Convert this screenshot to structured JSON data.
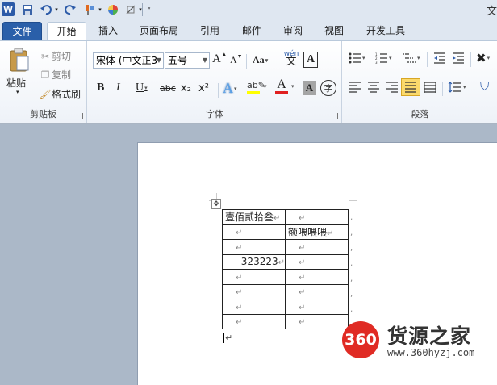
{
  "window": {
    "title_partial": "文"
  },
  "qat": {
    "logo": "W",
    "undo_icon": "undo-icon",
    "redo_icon": "redo-icon"
  },
  "tabs": [
    "文件",
    "开始",
    "插入",
    "页面布局",
    "引用",
    "邮件",
    "审阅",
    "视图",
    "开发工具"
  ],
  "active_tab": "开始",
  "clipboard": {
    "paste": "粘贴",
    "cut": "剪切",
    "copy": "复制",
    "format_painter": "格式刷",
    "label": "剪贴板"
  },
  "font": {
    "font_name": "宋体 (中文正3",
    "font_size": "五号",
    "grow": "A",
    "shrink": "A",
    "case": "Aa",
    "wen": "文",
    "bold": "B",
    "italic": "I",
    "underline": "U",
    "strike": "abc",
    "sub": "x₂",
    "sup": "x²",
    "char_shade": "A",
    "enclose": "字",
    "label": "字体"
  },
  "paragraph": {
    "label": "段落"
  },
  "table": {
    "rows": [
      [
        "壹佰贰拾叁",
        ""
      ],
      [
        "",
        "额喂喂喂"
      ],
      [
        "",
        ""
      ],
      [
        "323223",
        ""
      ],
      [
        "",
        ""
      ],
      [
        "",
        ""
      ],
      [
        "",
        ""
      ],
      [
        "",
        ""
      ]
    ]
  },
  "marks": {
    "cell_end": "↵",
    "paragraph": "↵"
  },
  "watermark": {
    "badge": "360",
    "name": "货源之家",
    "url": "www.360hyzj.com"
  }
}
